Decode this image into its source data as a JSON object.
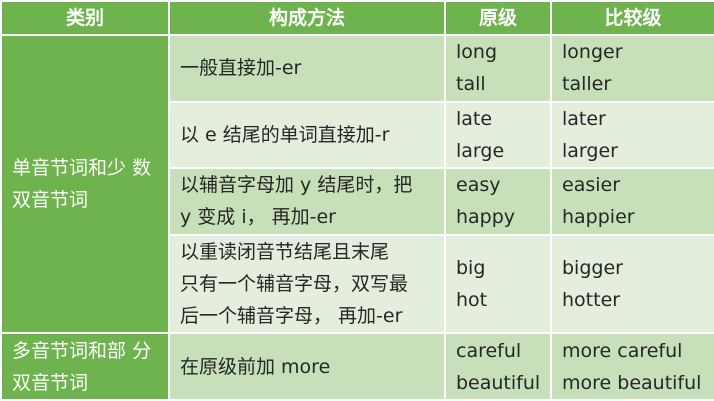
{
  "headers": [
    "类别",
    "构成方法",
    "原级",
    "比较级"
  ],
  "groups": [
    {
      "category_lines": [
        "单音节词和少",
        "数双音节词"
      ],
      "rows": [
        {
          "method_lines": [
            "一般直接加-er"
          ],
          "positive": [
            "long",
            "tall"
          ],
          "comparative": [
            "longer",
            "taller"
          ]
        },
        {
          "method_lines": [
            "以 e 结尾的单词直接加-r"
          ],
          "positive": [
            "late",
            "large"
          ],
          "comparative": [
            "later",
            "larger"
          ]
        },
        {
          "method_lines": [
            "以辅音字母加 y 结尾时，把",
            "y 变成 i， 再加-er"
          ],
          "positive": [
            "easy",
            "happy"
          ],
          "comparative": [
            "easier",
            "happier"
          ]
        },
        {
          "method_lines": [
            "以重读闭音节结尾且末尾",
            "只有一个辅音字母，双写最",
            "后一个辅音字母， 再加-er"
          ],
          "positive": [
            "big",
            "hot"
          ],
          "comparative": [
            "bigger",
            "hotter"
          ]
        }
      ]
    },
    {
      "category_lines": [
        "多音节词和部",
        "分双音节词"
      ],
      "rows": [
        {
          "method_lines": [
            "在原级前加 more"
          ],
          "positive": [
            "careful",
            "beautiful"
          ],
          "comparative": [
            "more careful",
            "more beautiful"
          ]
        }
      ]
    }
  ],
  "colors": {
    "header_green": "#6fb34e",
    "row_dark": "#c7e0b9",
    "row_light": "#e3eedc"
  }
}
